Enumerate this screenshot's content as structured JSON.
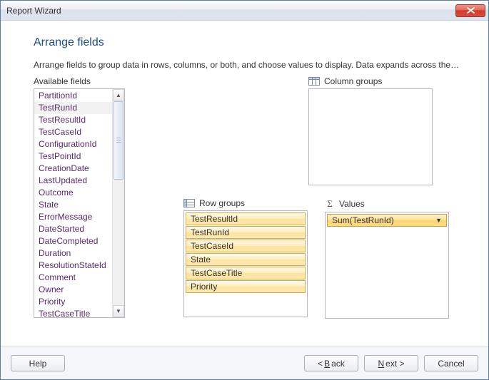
{
  "window": {
    "title": "Report Wizard"
  },
  "page": {
    "heading": "Arrange fields",
    "description": "Arrange fields to group data in rows, columns, or both, and choose values to display. Data expands across the page in column groups and down the page in row groups.  Use functions such as Sum, Avg, and Count on th..."
  },
  "labels": {
    "available": "Available fields",
    "column_groups": "Column groups",
    "row_groups": "Row groups",
    "values": "Values"
  },
  "available_fields": {
    "items": [
      "PartitionId",
      "TestRunId",
      "TestResultId",
      "TestCaseId",
      "ConfigurationId",
      "TestPointId",
      "CreationDate",
      "LastUpdated",
      "Outcome",
      "State",
      "ErrorMessage",
      "DateStarted",
      "DateCompleted",
      "Duration",
      "ResolutionStateId",
      "Comment",
      "Owner",
      "Priority",
      "TestCaseTitle"
    ],
    "selected_index": 1
  },
  "column_groups": [],
  "row_groups": [
    "TestResultId",
    "TestRunId",
    "TestCaseId",
    "State",
    "TestCaseTitle",
    "Priority"
  ],
  "values": {
    "items": [
      "Sum(TestRunId)"
    ],
    "selected_index": 0
  },
  "buttons": {
    "help": "Help",
    "back_pre": "< ",
    "back_u": "B",
    "back_post": "ack",
    "next_u": "N",
    "next_post": "ext >",
    "cancel": "Cancel"
  }
}
